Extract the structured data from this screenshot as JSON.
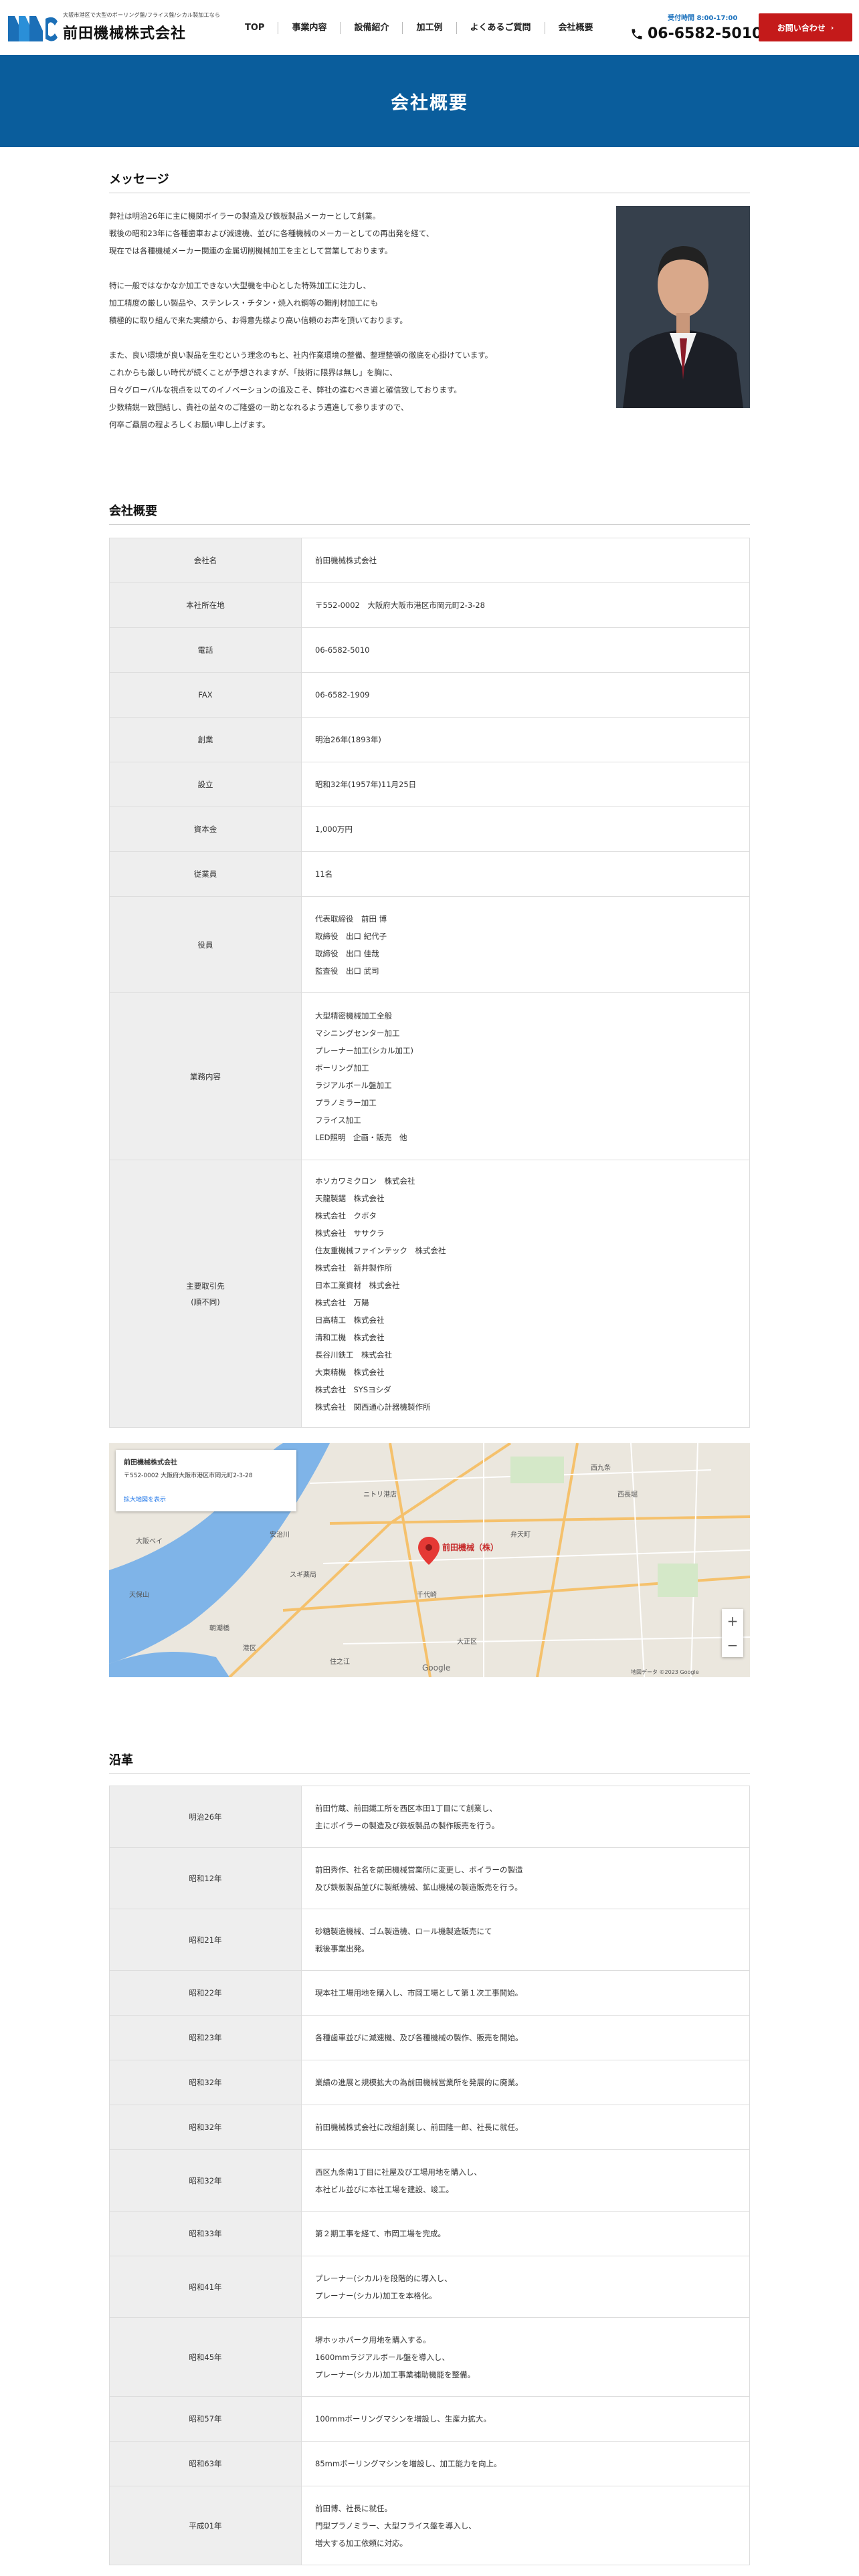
{
  "header": {
    "tagline": "大阪市港区で大型のボーリング盤/フライス盤/シカル製加工なら",
    "company": "前田機械株式会社",
    "nav": [
      "TOP",
      "事業内容",
      "設備紹介",
      "加工例",
      "よくあるご質問",
      "会社概要"
    ],
    "hours": "受付時間 8:00-17:00",
    "phone": "06-6582-5010",
    "contact": "お問い合わせ"
  },
  "banner": {
    "title": "会社概要"
  },
  "message": {
    "title": "メッセージ",
    "paragraphs": [
      [
        "弊社は明治26年に主に機関ボイラーの製造及び鉄板製品メーカーとして創業。",
        "戦後の昭和23年に各種歯車および減速機、並びに各種機械のメーカーとしての再出発を経て、",
        "現在では各種機械メーカー関連の金属切削機械加工を主として営業しております。"
      ],
      [
        "特に一般ではなかなか加工できない大型機を中心とした特殊加工に注力し、",
        "加工精度の厳しい製品や、ステンレス・チタン・焼入れ鋼等の難削材加工にも",
        "積極的に取り組んで来た実績から、お得意先様より高い信頼のお声を頂いております。"
      ],
      [
        "また、良い環境が良い製品を生むという理念のもと、社内作業環境の整備、整理整頓の徹底を心掛けています。",
        "これからも厳しい時代が続くことが予想されますが、「技術に限界は無し」を胸に、",
        "日々グローバルな視点を以てのイノベーションの追及こそ、弊社の進むべき道と確信致しております。",
        "少数精鋭一致団結し、貴社の益々のご隆盛の一助となれるよう邁進して参りますので、",
        "何卒ご贔屓の程よろしくお願い申し上げます。"
      ]
    ]
  },
  "overview": {
    "title": "会社概要",
    "rows": [
      {
        "label": "会社名",
        "value": [
          "前田機械株式会社"
        ]
      },
      {
        "label": "本社所在地",
        "value": [
          "〒552-0002　大阪府大阪市港区市岡元町2-3-28"
        ]
      },
      {
        "label": "電話",
        "value": [
          "06-6582-5010"
        ]
      },
      {
        "label": "FAX",
        "value": [
          "06-6582-1909"
        ]
      },
      {
        "label": "創業",
        "value": [
          "明治26年(1893年)"
        ]
      },
      {
        "label": "設立",
        "value": [
          "昭和32年(1957年)11月25日"
        ]
      },
      {
        "label": "資本金",
        "value": [
          "1,000万円"
        ]
      },
      {
        "label": "従業員",
        "value": [
          "11名"
        ]
      },
      {
        "label": "役員",
        "value": [
          "代表取締役　前田 博",
          "取締役　出口 紀代子",
          "取締役　出口 佳哉",
          "監査役　出口 武司"
        ]
      },
      {
        "label": "業務内容",
        "value": [
          "大型精密機械加工全般",
          "マシニングセンター加工",
          "プレーナー加工(シカル加工)",
          "ボーリング加工",
          "ラジアルボール盤加工",
          "プラノミラー加工",
          "フライス加工",
          "LED照明　企画・販売　他"
        ]
      },
      {
        "label": "主要取引先\n(順不同)",
        "value": [
          "ホソカワミクロン　株式会社",
          "天龍製鋸　株式会社",
          "株式会社　クボタ",
          "株式会社　ササクラ",
          "住友重機械ファインテック　株式会社",
          "株式会社　新井製作所",
          "日本工業資材　株式会社",
          "株式会社　万陽",
          "日高精工　株式会社",
          "清和工機　株式会社",
          "長谷川鉄工　株式会社",
          "大東精機　株式会社",
          "株式会社　SYSヨシダ",
          "株式会社　関西通心計器機製作所"
        ]
      }
    ]
  },
  "map": {
    "place": "前田機械株式会社",
    "address": "〒552-0002 大阪府大阪市港区市岡元町2-3-28",
    "link": "拡大地図を表示",
    "marker": "前田機械（株）",
    "labels": [
      "ニトリ港店",
      "西九条",
      "大阪ベイ",
      "弁天町",
      "港区",
      "住之江",
      "千代崎",
      "西長堀",
      "スギ薬局",
      "大正区",
      "天保山",
      "安治川",
      "朝潮橋"
    ],
    "zoom_in": "+",
    "zoom_out": "−",
    "google": "Google",
    "copyright": "地図データ ©2023 Google"
  },
  "history": {
    "title": "沿革",
    "rows": [
      {
        "label": "明治26年",
        "value": [
          "前田竹蔵、前田鐵工所を西区本田1丁目にて創業し、",
          "主にボイラーの製造及び鉄板製品の製作販売を行う。"
        ]
      },
      {
        "label": "昭和12年",
        "value": [
          "前田秀作、社名を前田機械営業所に変更し、ボイラーの製造",
          "及び鉄板製品並びに製紙機械、鉱山機械の製造販売を行う。"
        ]
      },
      {
        "label": "昭和21年",
        "value": [
          "砂糖製造機械、ゴム製造機、ロール機製造販売にて",
          "戦後事業出発。"
        ]
      },
      {
        "label": "昭和22年",
        "value": [
          "現本社工場用地を購入し、市岡工場として第１次工事開始。"
        ]
      },
      {
        "label": "昭和23年",
        "value": [
          "各種歯車並びに減速機、及び各種機械の製作、販売を開始。"
        ]
      },
      {
        "label": "昭和32年",
        "value": [
          "業績の進展と規模拡大の為前田機械営業所を発展的に廃業。"
        ]
      },
      {
        "label": "昭和32年",
        "value": [
          "前田機械株式会社に改組創業し、前田隆一郎、社長に就任。"
        ]
      },
      {
        "label": "昭和32年",
        "value": [
          "西区九条南1丁目に社屋及び工場用地を購入し、",
          "本社ビル並びに本社工場を建設、竣工。"
        ]
      },
      {
        "label": "昭和33年",
        "value": [
          "第２期工事を経て、市岡工場を完成。"
        ]
      },
      {
        "label": "昭和41年",
        "value": [
          "プレーナー(シカル)を段階的に導入し、",
          "プレーナー(シカル)加工を本格化。"
        ]
      },
      {
        "label": "昭和45年",
        "value": [
          "堺ホッホパーク用地を購入する。",
          "1600mmラジアルボール盤を導入し、",
          "プレーナー(シカル)加工事業補助機能を整備。"
        ]
      },
      {
        "label": "昭和57年",
        "value": [
          "100mmボーリングマシンを増設し、生産力拡大。"
        ]
      },
      {
        "label": "昭和63年",
        "value": [
          "85mmボーリングマシンを増設し、加工能力を向上。"
        ]
      },
      {
        "label": "平成01年",
        "value": [
          "前田博、社長に就任。",
          "門型プラノミラー、大型フライス盤を導入し、",
          "増大する加工依頼に対応。"
        ]
      }
    ]
  }
}
